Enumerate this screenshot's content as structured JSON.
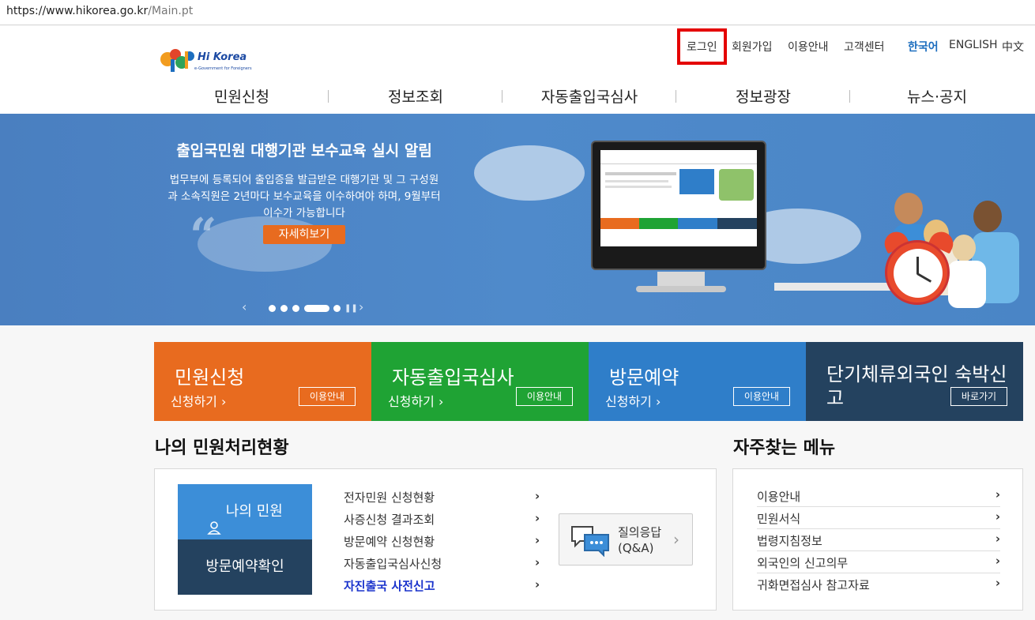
{
  "browser": {
    "url_host": "https://www.hikorea.go.kr",
    "url_path": "/Main.pt"
  },
  "brand": {
    "logo_text": "Hi Korea",
    "logo_sub": "e-Government for Foreigners"
  },
  "topnav": {
    "login": "로그인",
    "signup": "회원가입",
    "guide": "이용안내",
    "support": "고객센터",
    "lang_ko": "한국어",
    "lang_en": "ENGLISH",
    "lang_zh": "中文"
  },
  "mainnav": [
    "민원신청",
    "정보조회",
    "자동출입국심사",
    "정보광장",
    "뉴스·공지"
  ],
  "banner": {
    "title": "출입국민원 대행기관 보수교육 실시 알림",
    "body": "법무부에 등록되어 출입증을 발급받은 대행기관 및 그 구성원과 소속직원은 2년마다 보수교육을 이수하여야 하며, 9월부터 이수가 가능합니다",
    "button": "자세히보기",
    "prev": "‹",
    "next": "›",
    "pause": "❚❚"
  },
  "tiles": [
    {
      "title": "민원신청",
      "sub": "신청하기 ›",
      "btn": "이용안내",
      "color": "#e86b1f"
    },
    {
      "title": "자동출입국심사",
      "sub": "신청하기 ›",
      "btn": "이용안내",
      "color": "#1fa334"
    },
    {
      "title": "방문예약",
      "sub": "신청하기 ›",
      "btn": "이용안내",
      "color": "#2f7ec9"
    },
    {
      "title": "단기체류외국인 숙박신고",
      "sub": "",
      "btn": "바로가기",
      "color": "#24425f"
    }
  ],
  "my_status": {
    "title": "나의 민원처리현황",
    "my_civil": "나의 민원",
    "visit_check": "방문예약확인",
    "links": [
      "전자민원 신청현황",
      "사증신청 결과조회",
      "방문예약 신청현황",
      "자동출입국심사신청",
      "자진출국 사전신고"
    ],
    "qa_line1": "질의응답",
    "qa_line2": "(Q&A)"
  },
  "favorites": {
    "title": "자주찾는 메뉴",
    "items": [
      "이용안내",
      "민원서식",
      "법령지침정보",
      "외국인의 신고의무",
      "귀화면접심사 참고자료"
    ]
  }
}
